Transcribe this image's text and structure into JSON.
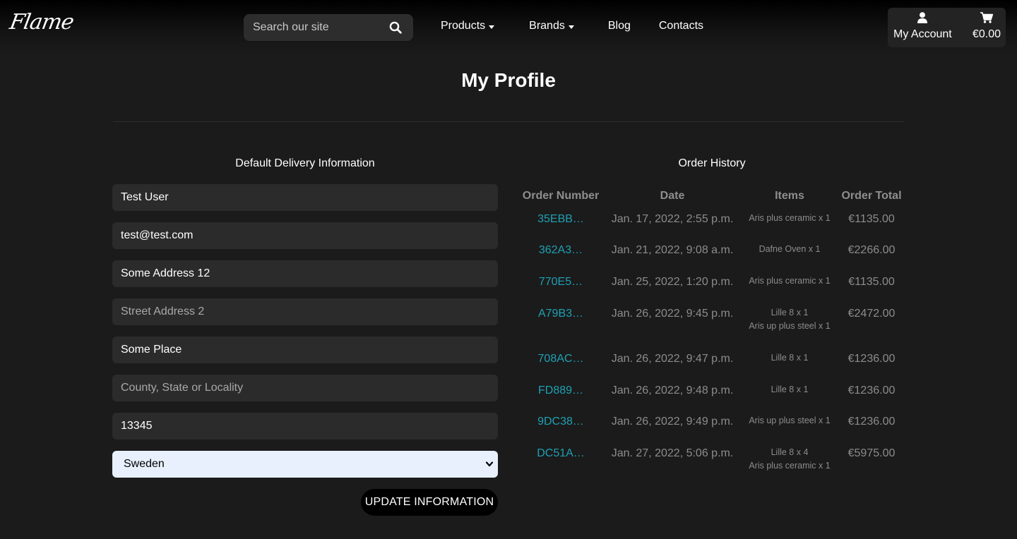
{
  "header": {
    "logo": "Flame",
    "search_placeholder": "Search our site",
    "nav": {
      "products": "Products",
      "brands": "Brands",
      "blog": "Blog",
      "contacts": "Contacts"
    },
    "account_label": "My Account",
    "cart_total": "€0.00"
  },
  "page": {
    "title": "My Profile"
  },
  "delivery": {
    "title": "Default Delivery Information",
    "full_name": "Test User",
    "email": "test@test.com",
    "street1": "Some Address 12",
    "street2_placeholder": "Street Address 2",
    "town": "Some Place",
    "county_placeholder": "County, State or Locality",
    "postcode": "13345",
    "country": "Sweden",
    "update_label": "UPDATE INFORMATION"
  },
  "orders": {
    "title": "Order History",
    "headers": [
      "Order Number",
      "Date",
      "Items",
      "Order Total"
    ],
    "rows": [
      {
        "number": "35EBB…",
        "date": "Jan. 17, 2022, 2:55 p.m.",
        "items": [
          "Aris plus ceramic x 1"
        ],
        "total": "€1135.00"
      },
      {
        "number": "362A3…",
        "date": "Jan. 21, 2022, 9:08 a.m.",
        "items": [
          "Dafne Oven x 1"
        ],
        "total": "€2266.00"
      },
      {
        "number": "770E5…",
        "date": "Jan. 25, 2022, 1:20 p.m.",
        "items": [
          "Aris plus ceramic x 1"
        ],
        "total": "€1135.00"
      },
      {
        "number": "A79B3…",
        "date": "Jan. 26, 2022, 9:45 p.m.",
        "items": [
          "Lille 8 x 1",
          "Aris up plus steel x 1"
        ],
        "total": "€2472.00"
      },
      {
        "number": "708AC…",
        "date": "Jan. 26, 2022, 9:47 p.m.",
        "items": [
          "Lille 8 x 1"
        ],
        "total": "€1236.00"
      },
      {
        "number": "FD889…",
        "date": "Jan. 26, 2022, 9:48 p.m.",
        "items": [
          "Lille 8 x 1"
        ],
        "total": "€1236.00"
      },
      {
        "number": "9DC38…",
        "date": "Jan. 26, 2022, 9:49 p.m.",
        "items": [
          "Aris up plus steel x 1"
        ],
        "total": "€1236.00"
      },
      {
        "number": "DC51A…",
        "date": "Jan. 27, 2022, 5:06 p.m.",
        "items": [
          "Lille 8 x 4",
          "Aris plus ceramic x 1"
        ],
        "total": "€5975.00"
      }
    ]
  },
  "icons": {
    "search": "search-icon",
    "user": "user-icon",
    "cart": "cart-icon",
    "caret": "caret-down-icon",
    "select": "chevron-down-icon"
  },
  "colors": {
    "background": "#1b1b1b",
    "field_bg": "#2b2b2b",
    "accent_link": "#1fa0b4",
    "muted_text": "#8c8c8c",
    "select_bg": "#e8f0fe"
  }
}
